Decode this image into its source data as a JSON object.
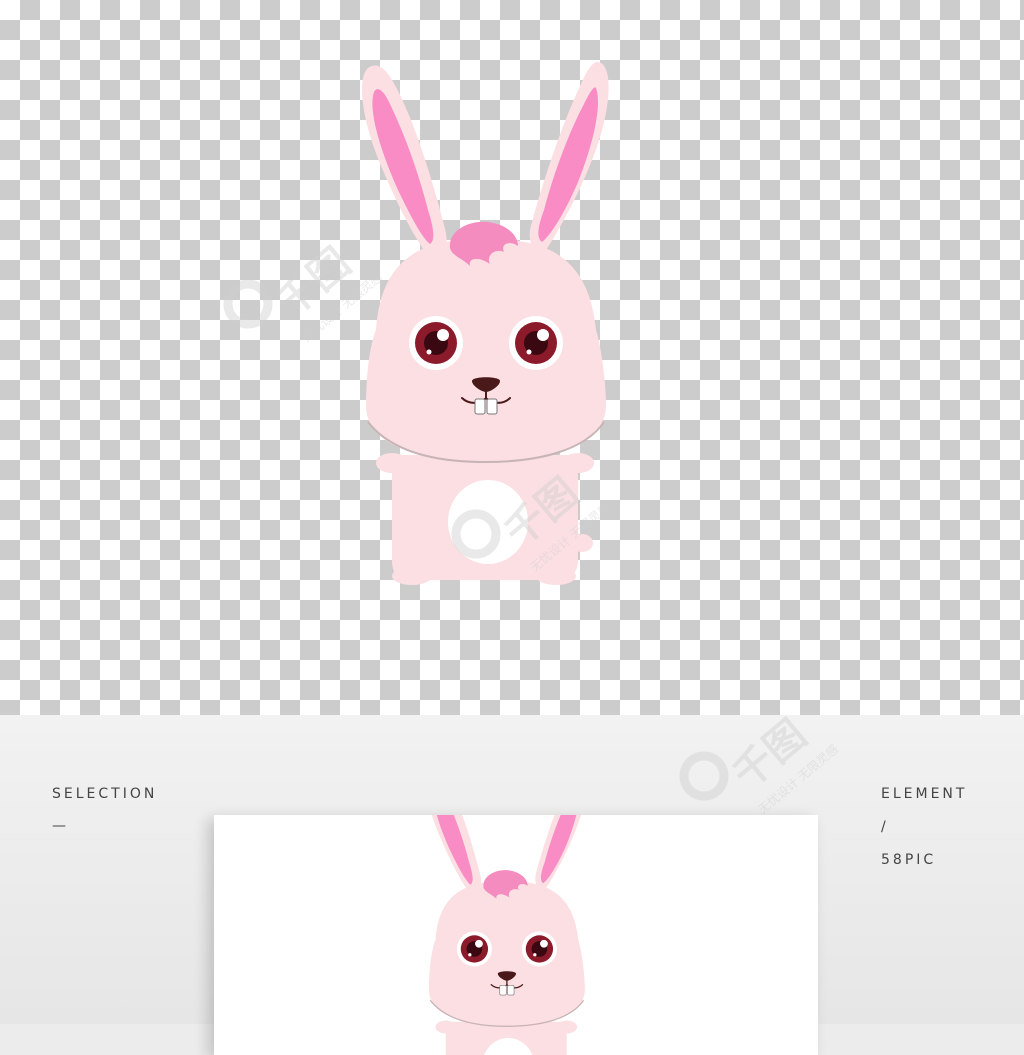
{
  "footer": {
    "left_title": "SELECTION",
    "left_mark": "—",
    "right_title": "ELEMENT",
    "right_slash": "/",
    "right_brand": "58PIC"
  },
  "watermark": {
    "logo_text": "千图",
    "tagline": "无忧设计 无限灵感"
  },
  "colors": {
    "body_pink": "#fcdfe3",
    "ear_inner": "#f98cc4",
    "tuft": "#f48cc0",
    "eye": "#8b1a2b",
    "belly": "#ffffff"
  }
}
